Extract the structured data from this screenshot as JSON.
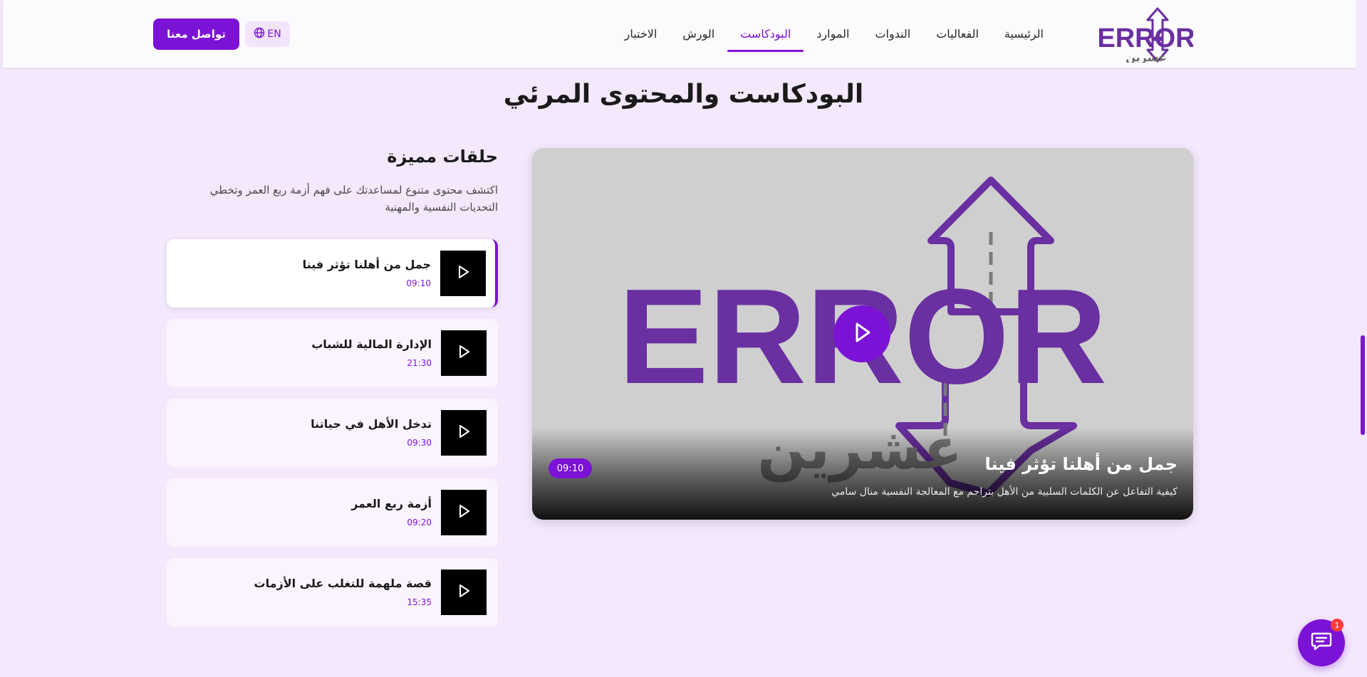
{
  "header": {
    "logo_text": "ERROR",
    "logo_subtext": "عشرين",
    "nav": [
      {
        "label": "الرئيسية",
        "active": false
      },
      {
        "label": "الفعاليات",
        "active": false
      },
      {
        "label": "الندوات",
        "active": false
      },
      {
        "label": "الموارد",
        "active": false
      },
      {
        "label": "البودكاست",
        "active": true
      },
      {
        "label": "الورش",
        "active": false
      },
      {
        "label": "الاختبار",
        "active": false
      }
    ],
    "lang_label": "EN",
    "lang_icon": "globe-icon",
    "contact_label": "تواصل معنا"
  },
  "page": {
    "title": "البودكاست والمحتوى المرئي"
  },
  "featured": {
    "heading": "حلقات مميزة",
    "description": "اكتشف محتوى متنوع لمساعدتك على فهم أزمة ربع العمر وتخطي التحديات النفسية والمهنية",
    "episodes": [
      {
        "title": "جمل من أهلنا تؤثر فينا",
        "duration": "09:10",
        "active": true
      },
      {
        "title": "الإدارة المالية للشباب",
        "duration": "21:30",
        "active": false
      },
      {
        "title": "تدخل الأهل في حياتنا",
        "duration": "09:30",
        "active": false
      },
      {
        "title": "أزمة ربع العمر",
        "duration": "09:20",
        "active": false
      },
      {
        "title": "قصة ملهمة للتغلب على الأزمات",
        "duration": "15:35",
        "active": false
      }
    ]
  },
  "video": {
    "title": "جمل من أهلنا تؤثر فينا",
    "description": "كيفية التفاعل عن الكلمات السلبية من الأهل بتراحم مع المعالجة النفسية منال سامي",
    "duration": "09:10",
    "art_text": "ERROR",
    "art_subtext": "عشرين"
  },
  "chat": {
    "badge_count": "1",
    "icon": "chat-icon"
  },
  "colors": {
    "accent": "#7c12d6",
    "background": "#f3e8fc",
    "logo_purple": "#6a2fa0"
  }
}
